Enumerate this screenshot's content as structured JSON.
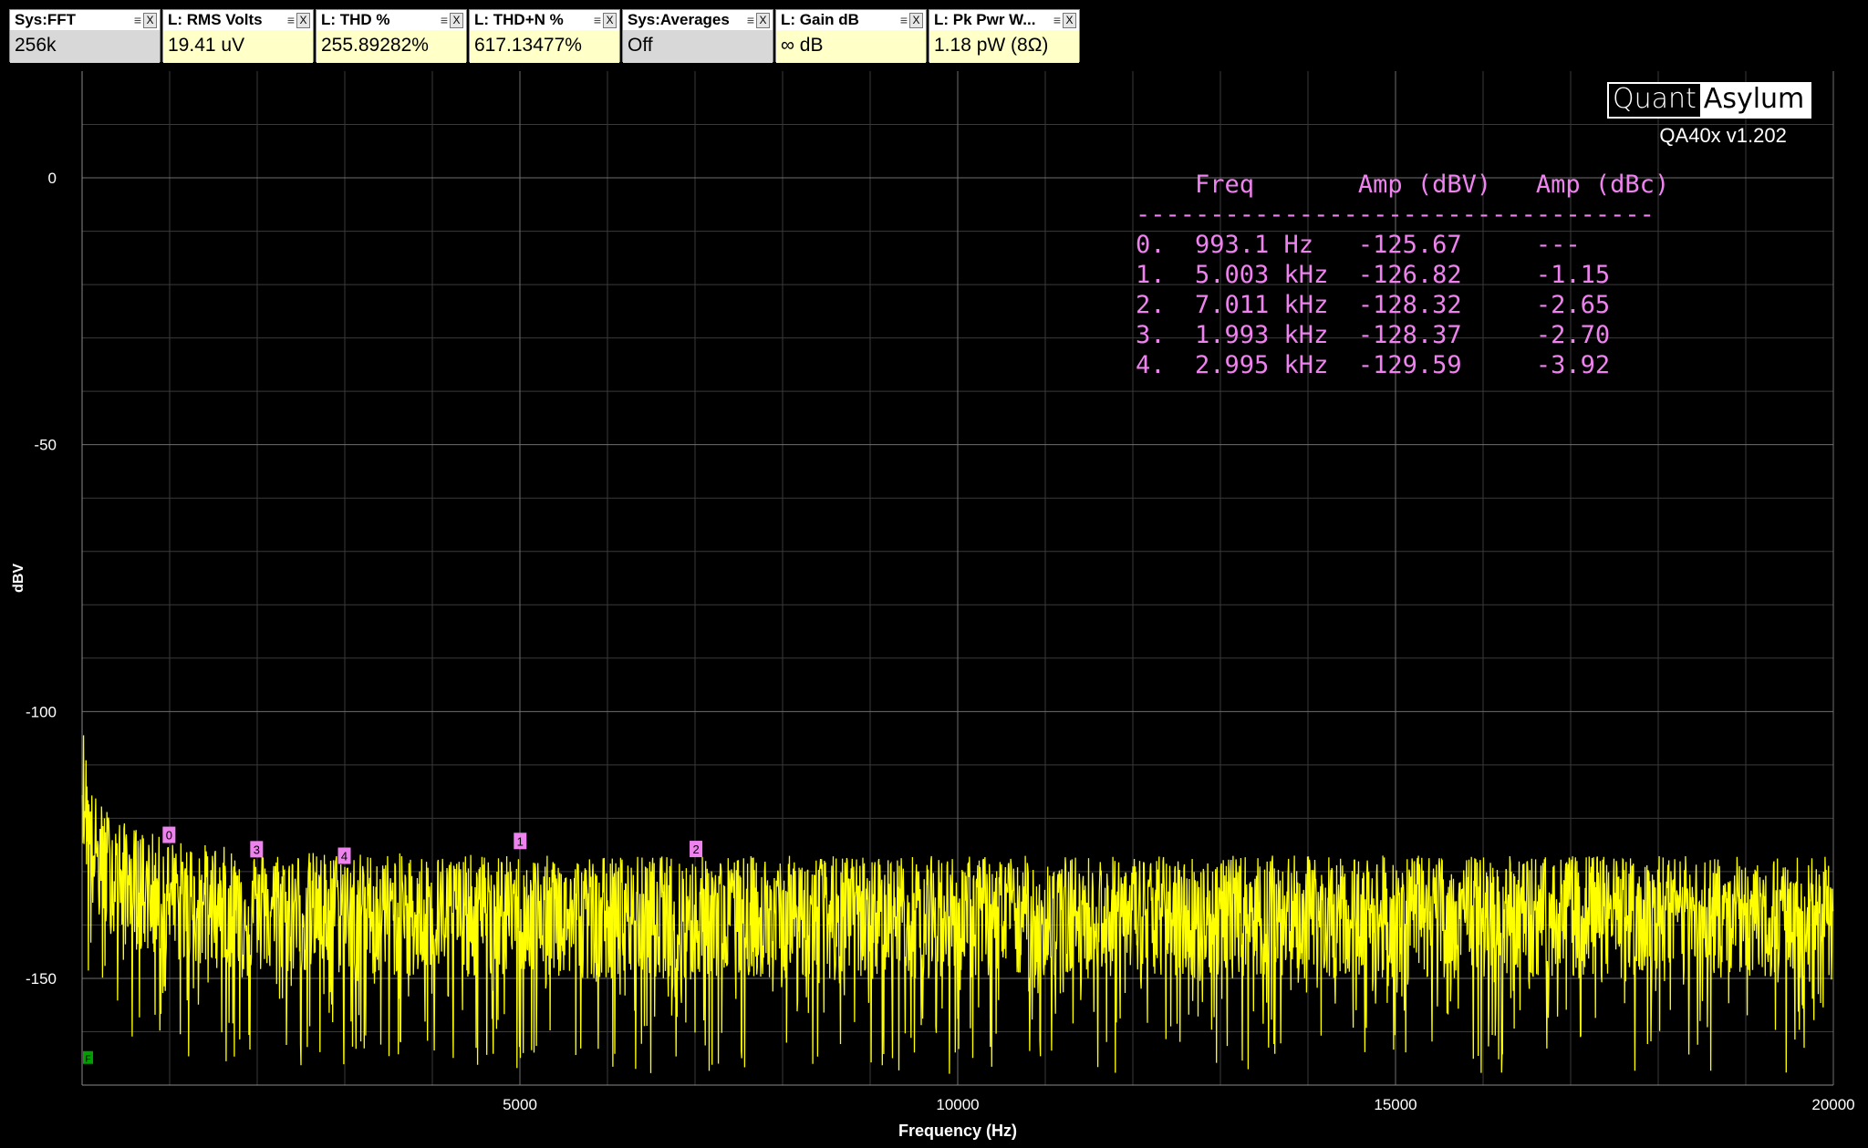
{
  "widgets": [
    {
      "title": "Sys:FFT",
      "value": "256k",
      "style": "grey"
    },
    {
      "title": "L: RMS Volts",
      "value": "19.41 uV",
      "style": "yellow"
    },
    {
      "title": "L: THD %",
      "value": "255.89282%",
      "style": "yellow"
    },
    {
      "title": "L: THD+N %",
      "value": "617.13477%",
      "style": "yellow"
    },
    {
      "title": "Sys:Averages",
      "value": "Off",
      "style": "grey"
    },
    {
      "title": "L: Gain dB",
      "value": "∞ dB",
      "style": "yellow"
    },
    {
      "title": "L: Pk Pwr W...",
      "value": "1.18 pW (8Ω)",
      "style": "yellow"
    }
  ],
  "widget_menu_glyph": "≡",
  "widget_close_glyph": "X",
  "logo": {
    "left": "Quant",
    "right": "Asylum",
    "version": "QA40x v1.202"
  },
  "peak_table": {
    "header": {
      "freq": "Freq",
      "amp_dbv": "Amp (dBV)",
      "amp_dbc": "Amp (dBc)"
    },
    "separator": "-----------------------------------",
    "rows": [
      {
        "index": "0.",
        "freq": "993.1 Hz",
        "amp_dbv": "-125.67",
        "amp_dbc": "---"
      },
      {
        "index": "1.",
        "freq": "5.003 kHz",
        "amp_dbv": "-126.82",
        "amp_dbc": "-1.15"
      },
      {
        "index": "2.",
        "freq": "7.011 kHz",
        "amp_dbv": "-128.32",
        "amp_dbc": "-2.65"
      },
      {
        "index": "3.",
        "freq": "1.993 kHz",
        "amp_dbv": "-128.37",
        "amp_dbc": "-2.70"
      },
      {
        "index": "4.",
        "freq": "2.995 kHz",
        "amp_dbv": "-129.59",
        "amp_dbc": "-3.92"
      }
    ]
  },
  "chart_data": {
    "type": "line",
    "xlabel": "Frequency (Hz)",
    "ylabel": "dBV",
    "xlim": [
      0,
      20000
    ],
    "ylim": [
      -170,
      20
    ],
    "x_ticks": [
      5000,
      10000,
      15000,
      20000
    ],
    "y_ticks": [
      0,
      -50,
      -100,
      -150
    ],
    "grid": true,
    "series": [
      {
        "color": "#ffff00",
        "noise_floor_dbv": -138,
        "points": [
          [
            0,
            -112
          ],
          [
            100,
            -125
          ],
          [
            200,
            -128
          ],
          [
            500,
            -132
          ],
          [
            1000,
            -135
          ],
          [
            2000,
            -137
          ],
          [
            5000,
            -138
          ],
          [
            10000,
            -138
          ],
          [
            15000,
            -138
          ],
          [
            20000,
            -138
          ]
        ]
      }
    ],
    "markers": [
      {
        "label": "0",
        "x": 993.1,
        "y": -125.67
      },
      {
        "label": "1",
        "x": 5003,
        "y": -126.82
      },
      {
        "label": "2",
        "x": 7011,
        "y": -128.32
      },
      {
        "label": "3",
        "x": 1993,
        "y": -128.37
      },
      {
        "label": "4",
        "x": 2995,
        "y": -129.59
      }
    ],
    "corner_marker": "F",
    "marker_color": "#ee82ee",
    "corner_marker_color": "#00a000"
  }
}
